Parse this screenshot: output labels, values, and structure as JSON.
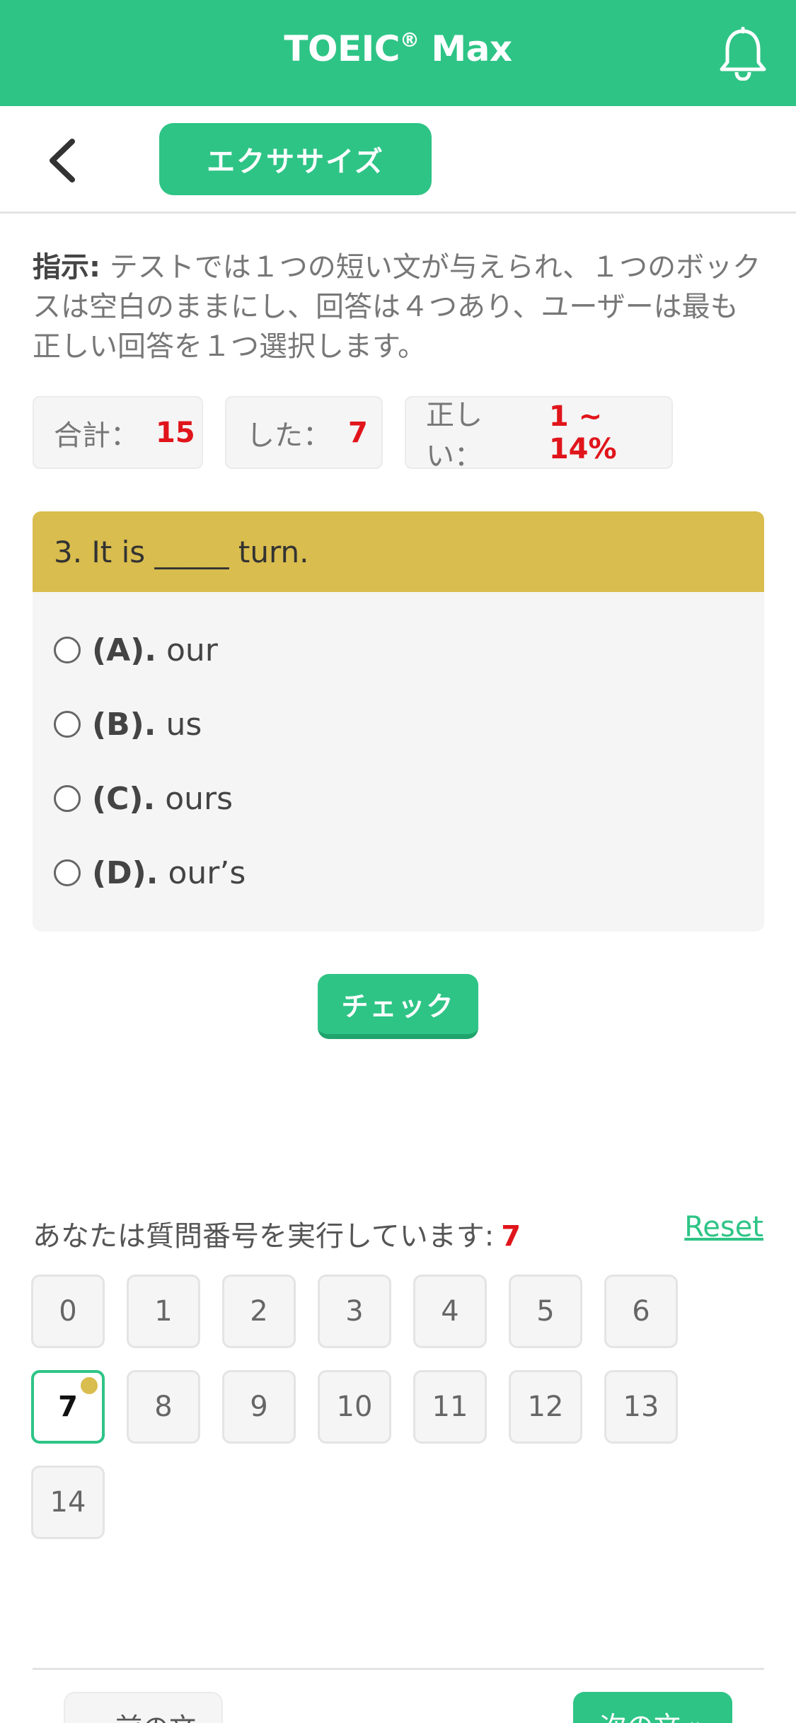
{
  "appbar": {
    "title": "TOEIC",
    "title_mark": "®",
    "title_suffix": " Max"
  },
  "subnav": {
    "tab_label": "エクササイズ"
  },
  "instruction": {
    "label": "指示:",
    "text": " テストでは１つの短い文が与えられ、１つのボックスは空白のままにし、回答は４つあり、ユーザーは最も正しい回答を１つ選択します。"
  },
  "stats": [
    {
      "label": "合計：",
      "value": "15"
    },
    {
      "label": "した：",
      "value": "7"
    },
    {
      "label": "正しい：",
      "value": "1 ~ 14%"
    }
  ],
  "question": {
    "text": "3. It is _____ turn.",
    "options": [
      {
        "letter": "(A).",
        "text": "our"
      },
      {
        "letter": "(B).",
        "text": "us"
      },
      {
        "letter": "(C).",
        "text": "ours"
      },
      {
        "letter": "(D).",
        "text": "our’s"
      }
    ]
  },
  "check_button": "チェック",
  "progress": {
    "label": "あなたは質問番号を実行しています:",
    "current": "7",
    "reset": "Reset"
  },
  "question_numbers": [
    "0",
    "1",
    "2",
    "3",
    "4",
    "5",
    "6",
    "7",
    "8",
    "9",
    "10",
    "11",
    "12",
    "13",
    "14"
  ],
  "footer": {
    "prev": "« 前の文",
    "next": "次の文 »"
  },
  "colors": {
    "primary": "#2ec486",
    "question_header": "#d9bd4e",
    "accent_red": "#e0151b"
  }
}
